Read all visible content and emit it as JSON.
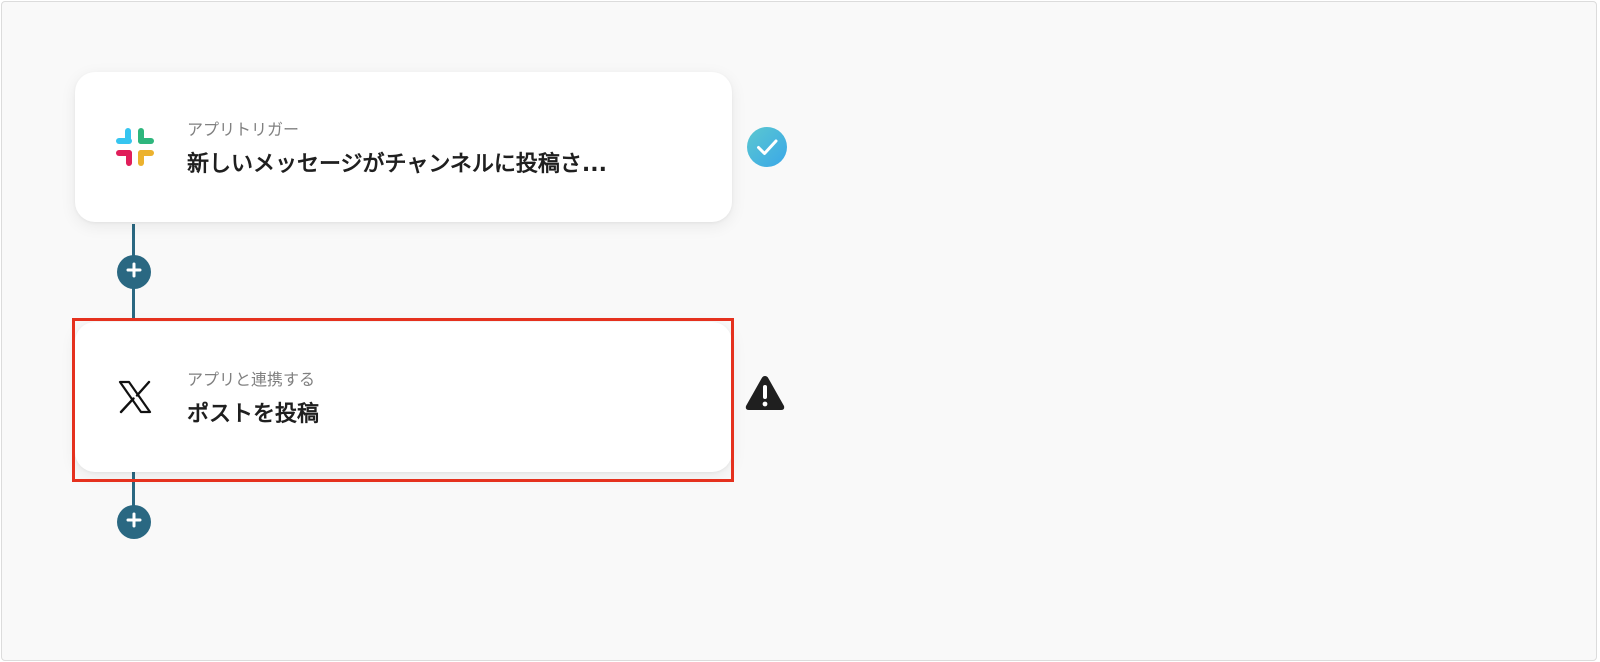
{
  "flow": {
    "steps": [
      {
        "app_icon": "slack-icon",
        "subtitle": "アプリトリガー",
        "title": "新しいメッセージがチャンネルに投稿さ...",
        "status": "check-icon"
      },
      {
        "app_icon": "x-logo-icon",
        "subtitle": "アプリと連携する",
        "title": "ポストを投稿",
        "status": "warning-icon"
      }
    ],
    "add_button_icon": "plus-icon"
  },
  "colors": {
    "connector": "#2a6882",
    "highlight": "#e5311e",
    "check_gradient_start": "#5bc8d0",
    "check_gradient_end": "#3aa7e8",
    "warning": "#1f1f1f"
  }
}
